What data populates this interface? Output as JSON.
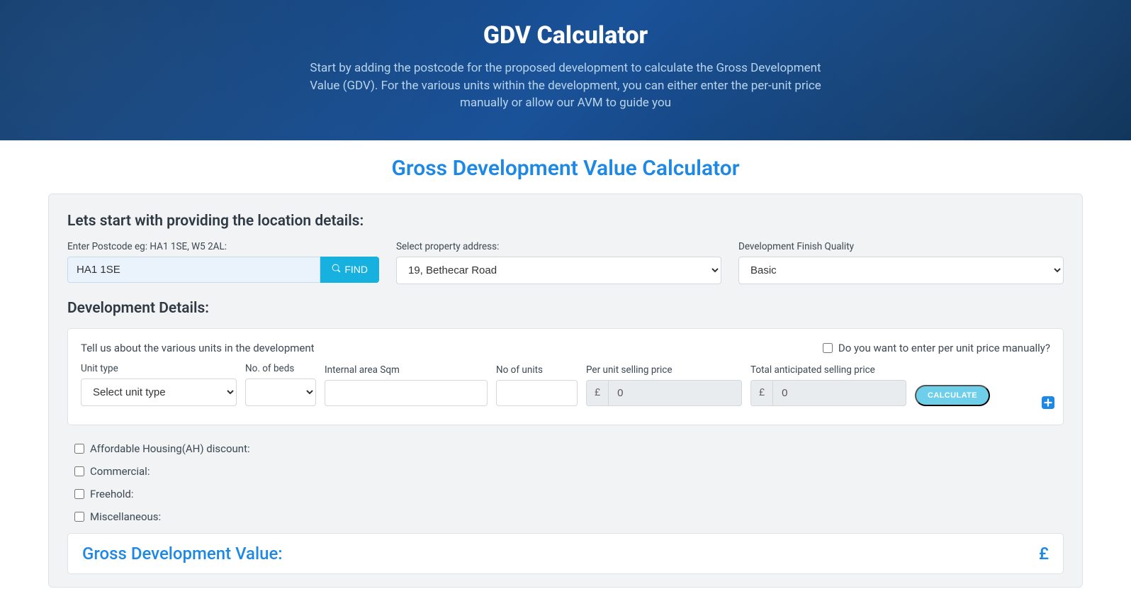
{
  "hero": {
    "title": "GDV Calculator",
    "subtitle": "Start by adding the postcode for the proposed development to calculate the Gross Development Value (GDV). For the various units within the development, you can either enter the per-unit price manually or allow our AVM to guide you"
  },
  "section_title": "Gross Development Value Calculator",
  "location": {
    "heading": "Lets start with providing the location details:",
    "postcode_label": "Enter Postcode eg: HA1 1SE, W5 2AL:",
    "postcode_value": "HA1 1SE",
    "find_label": "FIND",
    "address_label": "Select property address:",
    "address_value": "19, Bethecar Road",
    "quality_label": "Development Finish Quality",
    "quality_value": "Basic"
  },
  "dev": {
    "heading": "Development Details:",
    "intro": "Tell us about the various units in the development",
    "manual_label": "Do you want to enter per unit price manually?",
    "columns": {
      "unit_type": "Unit type",
      "no_beds": "No. of beds",
      "area": "Internal area Sqm",
      "no_units": "No of units",
      "per_unit": "Per unit selling price",
      "total": "Total anticipated selling price"
    },
    "row": {
      "unit_type_placeholder": "Select unit type",
      "per_unit_value": "0",
      "total_value": "0",
      "currency": "£"
    },
    "calculate_label": "CALCULATE"
  },
  "checks": {
    "ah": "Affordable Housing(AH) discount:",
    "commercial": "Commercial:",
    "freehold": "Freehold:",
    "misc": "Miscellaneous:"
  },
  "gdv": {
    "title": "Gross Development Value:",
    "value": "£"
  }
}
